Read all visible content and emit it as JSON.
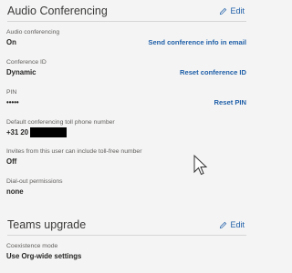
{
  "audio": {
    "title": "Audio Conferencing",
    "edit_label": "Edit",
    "fields": [
      {
        "label": "Audio conferencing",
        "value": "On",
        "action": "Send conference info in email"
      },
      {
        "label": "Conference ID",
        "value": "Dynamic",
        "action": "Reset conference ID"
      },
      {
        "label": "PIN",
        "value": "•••••",
        "action": "Reset PIN"
      },
      {
        "label": "Default conferencing toll phone number",
        "value": "+31 20"
      },
      {
        "label": "Invites from this user can include toll-free number",
        "value": "Off"
      },
      {
        "label": "Dial-out permissions",
        "value": "none"
      }
    ]
  },
  "teams": {
    "title": "Teams upgrade",
    "edit_label": "Edit",
    "fields": [
      {
        "label": "Coexistence mode",
        "value": "Use Org-wide settings"
      }
    ]
  }
}
